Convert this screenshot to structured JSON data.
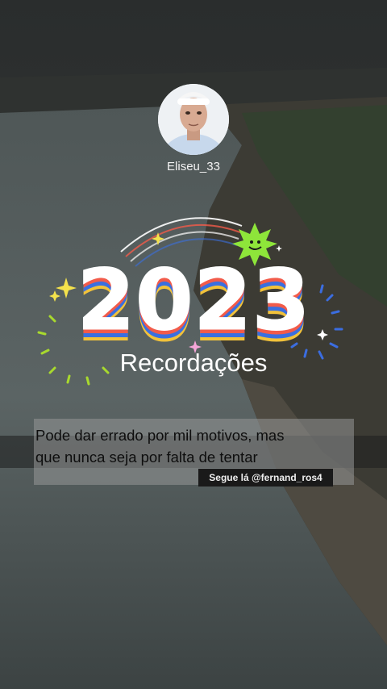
{
  "profile": {
    "username": "Eliseu_33",
    "avatar_icon": "user-avatar-icon"
  },
  "banner": {
    "year": "2023",
    "subtitle": "Recordações",
    "stripe_colors": [
      "#3a6fe0",
      "#f25b4a",
      "#f2c23a"
    ]
  },
  "quote": {
    "line1": "Pode dar errado por mil motivos, mas",
    "line2": "que nunca seja por falta de tentar",
    "credit": "Segue lá @fernand_ros4"
  },
  "colors": {
    "background": "#2b2f2f",
    "water": "#5b6464",
    "riverbank": "#4a473f",
    "sun_icon": "#8ee53a",
    "sparkle": "#f4e24c",
    "burst": "#3b6de0"
  }
}
